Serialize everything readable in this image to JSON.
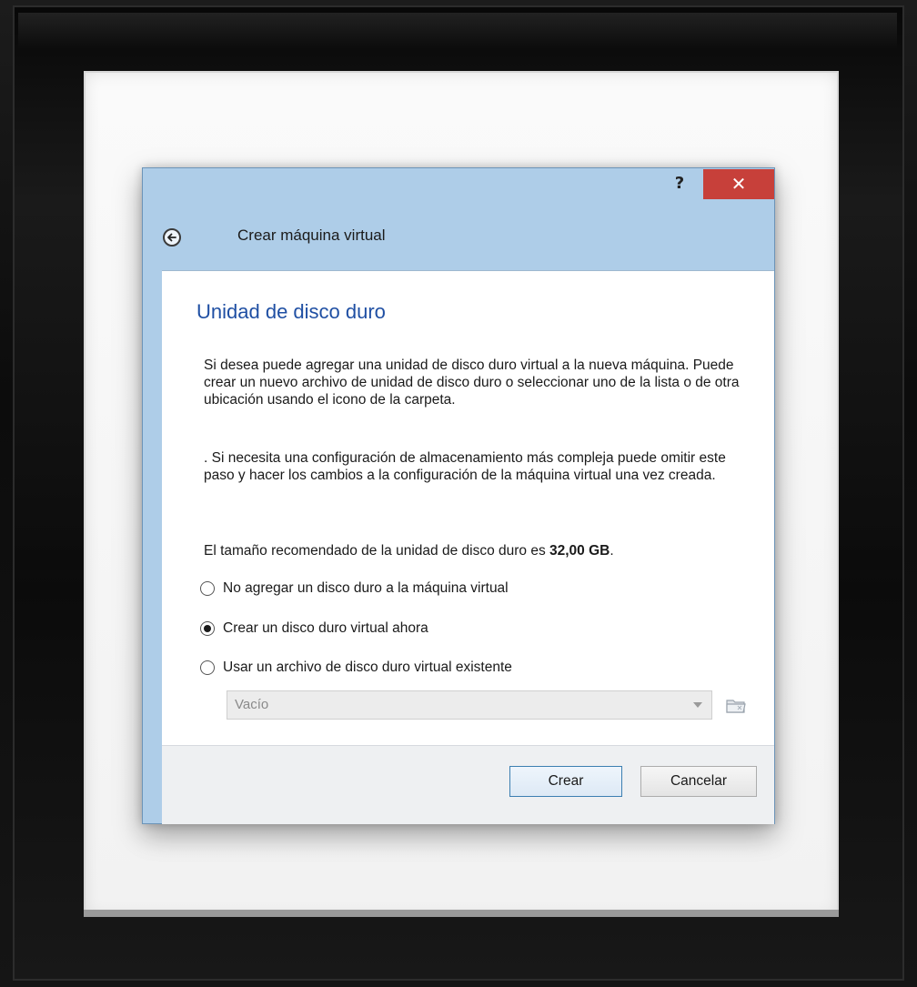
{
  "dialog": {
    "title": "Crear máquina virtual",
    "help_label": "?",
    "close_label": "✕"
  },
  "page": {
    "heading": "Unidad de disco duro",
    "paragraph1": "Si desea puede agregar una unidad de disco duro virtual a la nueva máquina. Puede crear un nuevo archivo de unidad de disco duro o seleccionar uno de la lista o de otra ubicación usando el icono de la carpeta.",
    "paragraph2": ". Si necesita una configuración de almacenamiento más compleja puede omitir este paso y hacer los cambios a la configuración de la máquina virtual una vez creada.",
    "recommended_prefix": "El tamaño recomendado de la unidad de disco duro es ",
    "recommended_size": "32,00 GB",
    "recommended_suffix": "."
  },
  "options": [
    {
      "label": "No agregar un disco duro a la máquina virtual",
      "checked": false
    },
    {
      "label": "Crear un disco duro virtual ahora",
      "checked": true
    },
    {
      "label": "Usar un archivo de disco duro virtual existente",
      "checked": false
    }
  ],
  "disk_select": {
    "value": "Vacío",
    "enabled": false
  },
  "buttons": {
    "create": "Crear",
    "cancel": "Cancelar"
  },
  "colors": {
    "heading": "#1f4fa3",
    "close": "#c7403a",
    "titlebar": "#aecde8"
  }
}
